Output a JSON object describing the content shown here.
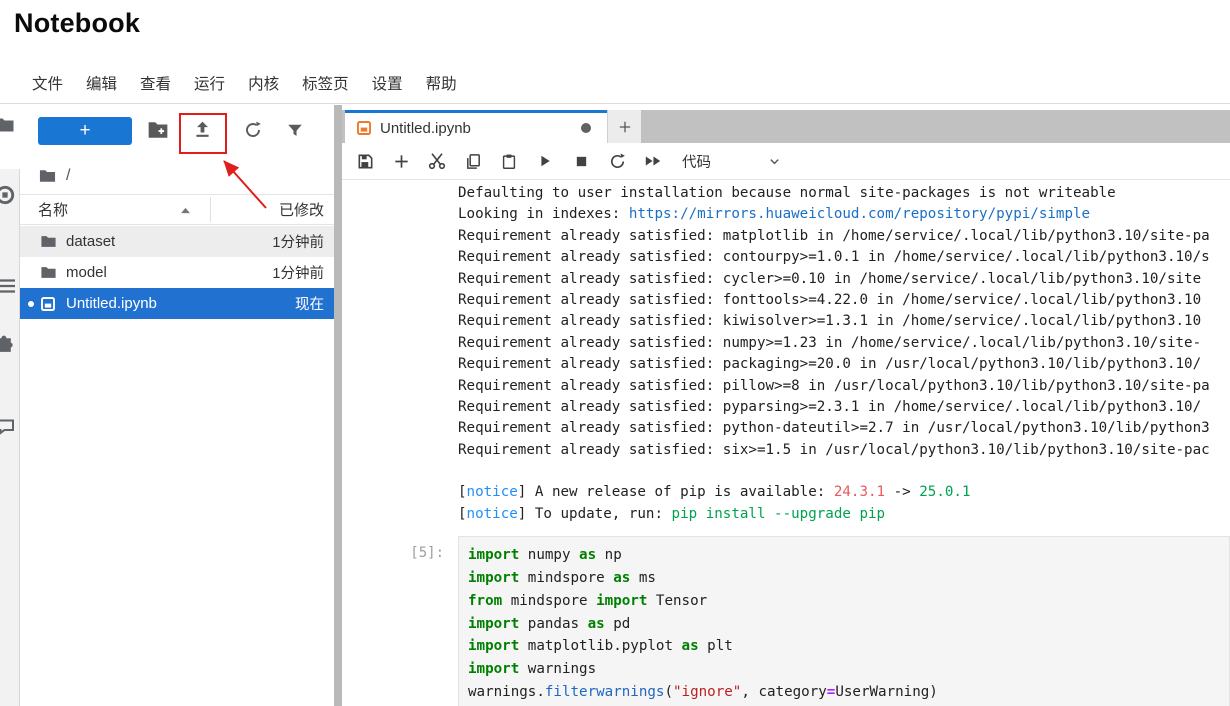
{
  "window": {
    "title": "Notebook"
  },
  "menu": {
    "items": [
      "文件",
      "编辑",
      "查看",
      "运行",
      "内核",
      "标签页",
      "设置",
      "帮助"
    ]
  },
  "sidebar": {
    "new_button_label": "+",
    "breadcrumb_root": "/",
    "columns": {
      "name": "名称",
      "modified": "已修改"
    },
    "files": [
      {
        "name": "dataset",
        "type": "folder",
        "modified": "1分钟前",
        "state": "hover"
      },
      {
        "name": "model",
        "type": "folder",
        "modified": "1分钟前",
        "state": "normal"
      },
      {
        "name": "Untitled.ipynb",
        "type": "notebook",
        "modified": "现在",
        "state": "selected",
        "unsaved_dot": true
      }
    ]
  },
  "tabbar": {
    "active_tab": {
      "title": "Untitled.ipynb",
      "unsaved": true
    },
    "new_tab_label": "+"
  },
  "nb_toolbar": {
    "cell_type_selector": "代码"
  },
  "output": {
    "lines": [
      [
        {
          "v": "Defaulting to user installation because normal site-packages is not writeable"
        }
      ],
      [
        {
          "v": "Looking in indexes: "
        },
        {
          "v": "https://mirrors.huaweicloud.com/repository/pypi/simple",
          "c": "link"
        }
      ],
      [
        {
          "v": "Requirement already satisfied: matplotlib in /home/service/.local/lib/python3.10/site-pa"
        }
      ],
      [
        {
          "v": "Requirement already satisfied: contourpy>=1.0.1 in /home/service/.local/lib/python3.10/s"
        }
      ],
      [
        {
          "v": "Requirement already satisfied: cycler>=0.10 in /home/service/.local/lib/python3.10/site"
        }
      ],
      [
        {
          "v": "Requirement already satisfied: fonttools>=4.22.0 in /home/service/.local/lib/python3.10"
        }
      ],
      [
        {
          "v": "Requirement already satisfied: kiwisolver>=1.3.1 in /home/service/.local/lib/python3.10"
        }
      ],
      [
        {
          "v": "Requirement already satisfied: numpy>=1.23 in /home/service/.local/lib/python3.10/site-"
        }
      ],
      [
        {
          "v": "Requirement already satisfied: packaging>=20.0 in /usr/local/python3.10/lib/python3.10/"
        }
      ],
      [
        {
          "v": "Requirement already satisfied: pillow>=8 in /usr/local/python3.10/lib/python3.10/site-pa"
        }
      ],
      [
        {
          "v": "Requirement already satisfied: pyparsing>=2.3.1 in /home/service/.local/lib/python3.10/"
        }
      ],
      [
        {
          "v": "Requirement already satisfied: python-dateutil>=2.7 in /usr/local/python3.10/lib/python3"
        }
      ],
      [
        {
          "v": "Requirement already satisfied: six>=1.5 in /usr/local/python3.10/lib/python3.10/site-pac"
        }
      ],
      [
        {
          "v": ""
        }
      ],
      [
        {
          "v": "["
        },
        {
          "v": "notice",
          "c": "blue"
        },
        {
          "v": "] A new release of pip is available: "
        },
        {
          "v": "24.3.1",
          "c": "red"
        },
        {
          "v": " -> "
        },
        {
          "v": "25.0.1",
          "c": "green"
        }
      ],
      [
        {
          "v": "["
        },
        {
          "v": "notice",
          "c": "blue"
        },
        {
          "v": "] To update, run: "
        },
        {
          "v": "pip install --upgrade pip",
          "c": "green"
        }
      ]
    ]
  },
  "cell": {
    "prompt": "[5]:",
    "lines": [
      [
        {
          "t": "kw",
          "v": "import"
        },
        {
          "t": "txt",
          "v": " numpy "
        },
        {
          "t": "kw",
          "v": "as"
        },
        {
          "t": "txt",
          "v": " np"
        }
      ],
      [
        {
          "t": "kw",
          "v": "import"
        },
        {
          "t": "txt",
          "v": " mindspore "
        },
        {
          "t": "kw",
          "v": "as"
        },
        {
          "t": "txt",
          "v": " ms"
        }
      ],
      [
        {
          "t": "kw",
          "v": "from"
        },
        {
          "t": "txt",
          "v": " mindspore "
        },
        {
          "t": "kw",
          "v": "import"
        },
        {
          "t": "txt",
          "v": " Tensor"
        }
      ],
      [
        {
          "t": "kw",
          "v": "import"
        },
        {
          "t": "txt",
          "v": " pandas "
        },
        {
          "t": "kw",
          "v": "as"
        },
        {
          "t": "txt",
          "v": " pd"
        }
      ],
      [
        {
          "t": "kw",
          "v": "import"
        },
        {
          "t": "txt",
          "v": " matplotlib.pyplot "
        },
        {
          "t": "kw",
          "v": "as"
        },
        {
          "t": "txt",
          "v": " plt"
        }
      ],
      [
        {
          "t": "kw",
          "v": "import"
        },
        {
          "t": "txt",
          "v": " warnings"
        }
      ],
      [
        {
          "t": "txt",
          "v": "warnings."
        },
        {
          "t": "prop",
          "v": "filterwarnings"
        },
        {
          "t": "txt",
          "v": "("
        },
        {
          "t": "str",
          "v": "\"ignore\""
        },
        {
          "t": "txt",
          "v": ", category"
        },
        {
          "t": "op",
          "v": "="
        },
        {
          "t": "txt",
          "v": "UserWarning)"
        }
      ]
    ]
  },
  "colors": {
    "accent": "#1976d2",
    "selected_row": "#2172d0",
    "tabbar_bg": "#c1c1c1",
    "ansi_blue": "#208ffb",
    "ansi_red": "#e75c58",
    "ansi_green": "#00a250",
    "link": "#1a6fc7",
    "keyword_green": "#008000",
    "string_red": "#ba2121",
    "operator_purple": "#aa22ff",
    "function_blue": "#2166c0",
    "notebook_orange": "#f37726",
    "annotation_red": "#e01e1e"
  }
}
